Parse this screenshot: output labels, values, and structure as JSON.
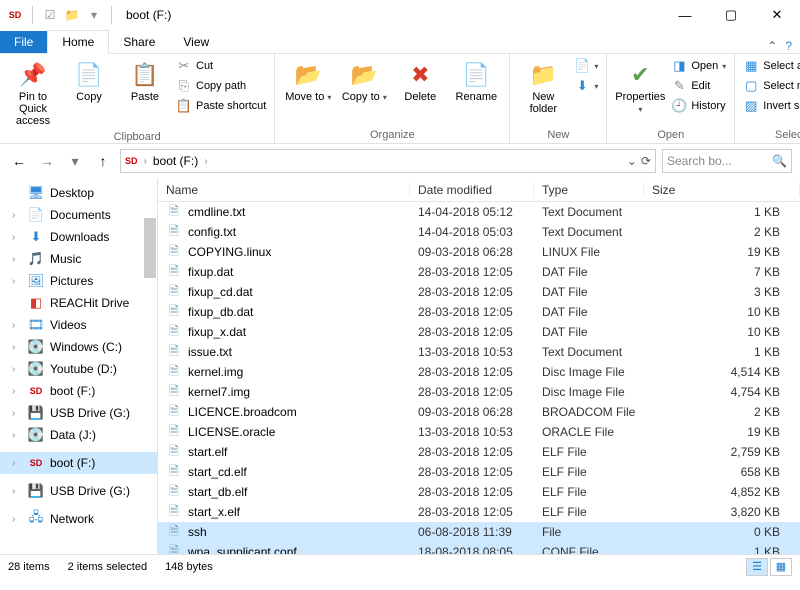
{
  "title": "boot (F:)",
  "ribbon_tabs": {
    "file": "File",
    "home": "Home",
    "share": "Share",
    "view": "View"
  },
  "ribbon": {
    "clipboard": {
      "pin": "Pin to Quick access",
      "copy": "Copy",
      "paste": "Paste",
      "cut": "Cut",
      "copy_path": "Copy path",
      "paste_shortcut": "Paste shortcut",
      "label": "Clipboard"
    },
    "organize": {
      "move_to": "Move to",
      "copy_to": "Copy to",
      "delete": "Delete",
      "rename": "Rename",
      "label": "Organize"
    },
    "new": {
      "new_folder": "New folder",
      "label": "New"
    },
    "open": {
      "properties": "Properties",
      "open": "Open",
      "edit": "Edit",
      "history": "History",
      "label": "Open"
    },
    "select": {
      "select_all": "Select all",
      "select_none": "Select none",
      "invert": "Invert selection",
      "label": "Select"
    }
  },
  "address": {
    "crumb1": "boot (F:)",
    "search_placeholder": "Search bo..."
  },
  "nav_tree": [
    {
      "icon": "desktop",
      "label": "Desktop",
      "exp": ""
    },
    {
      "icon": "doc",
      "label": "Documents",
      "exp": "›"
    },
    {
      "icon": "download",
      "label": "Downloads",
      "exp": "›"
    },
    {
      "icon": "music",
      "label": "Music",
      "exp": "›"
    },
    {
      "icon": "picture",
      "label": "Pictures",
      "exp": "›"
    },
    {
      "icon": "reachit",
      "label": "REACHit Drive",
      "exp": ""
    },
    {
      "icon": "video",
      "label": "Videos",
      "exp": "›"
    },
    {
      "icon": "drive",
      "label": "Windows (C:)",
      "exp": "›"
    },
    {
      "icon": "drive",
      "label": "Youtube (D:)",
      "exp": "›"
    },
    {
      "icon": "sd",
      "label": "boot (F:)",
      "exp": "›"
    },
    {
      "icon": "usb",
      "label": "USB Drive (G:)",
      "exp": "›"
    },
    {
      "icon": "drive",
      "label": "Data (J:)",
      "exp": "›"
    },
    {
      "spacer": true
    },
    {
      "icon": "sd",
      "label": "boot (F:)",
      "exp": "›",
      "selected": true
    },
    {
      "spacer": true
    },
    {
      "icon": "usb",
      "label": "USB Drive (G:)",
      "exp": "›"
    },
    {
      "spacer": true
    },
    {
      "icon": "network",
      "label": "Network",
      "exp": "›"
    }
  ],
  "columns": {
    "name": "Name",
    "date": "Date modified",
    "type": "Type",
    "size": "Size"
  },
  "files": [
    {
      "name": "cmdline.txt",
      "date": "14-04-2018 05:12",
      "type": "Text Document",
      "size": "1 KB"
    },
    {
      "name": "config.txt",
      "date": "14-04-2018 05:03",
      "type": "Text Document",
      "size": "2 KB"
    },
    {
      "name": "COPYING.linux",
      "date": "09-03-2018 06:28",
      "type": "LINUX File",
      "size": "19 KB"
    },
    {
      "name": "fixup.dat",
      "date": "28-03-2018 12:05",
      "type": "DAT File",
      "size": "7 KB"
    },
    {
      "name": "fixup_cd.dat",
      "date": "28-03-2018 12:05",
      "type": "DAT File",
      "size": "3 KB"
    },
    {
      "name": "fixup_db.dat",
      "date": "28-03-2018 12:05",
      "type": "DAT File",
      "size": "10 KB"
    },
    {
      "name": "fixup_x.dat",
      "date": "28-03-2018 12:05",
      "type": "DAT File",
      "size": "10 KB"
    },
    {
      "name": "issue.txt",
      "date": "13-03-2018 10:53",
      "type": "Text Document",
      "size": "1 KB"
    },
    {
      "name": "kernel.img",
      "date": "28-03-2018 12:05",
      "type": "Disc Image File",
      "size": "4,514 KB"
    },
    {
      "name": "kernel7.img",
      "date": "28-03-2018 12:05",
      "type": "Disc Image File",
      "size": "4,754 KB"
    },
    {
      "name": "LICENCE.broadcom",
      "date": "09-03-2018 06:28",
      "type": "BROADCOM File",
      "size": "2 KB"
    },
    {
      "name": "LICENSE.oracle",
      "date": "13-03-2018 10:53",
      "type": "ORACLE File",
      "size": "19 KB"
    },
    {
      "name": "start.elf",
      "date": "28-03-2018 12:05",
      "type": "ELF File",
      "size": "2,759 KB"
    },
    {
      "name": "start_cd.elf",
      "date": "28-03-2018 12:05",
      "type": "ELF File",
      "size": "658 KB"
    },
    {
      "name": "start_db.elf",
      "date": "28-03-2018 12:05",
      "type": "ELF File",
      "size": "4,852 KB"
    },
    {
      "name": "start_x.elf",
      "date": "28-03-2018 12:05",
      "type": "ELF File",
      "size": "3,820 KB"
    },
    {
      "name": "ssh",
      "date": "06-08-2018 11:39",
      "type": "File",
      "size": "0 KB",
      "selected": true
    },
    {
      "name": "wpa_supplicant.conf",
      "date": "18-08-2018 08:05",
      "type": "CONF File",
      "size": "1 KB",
      "selected": true
    }
  ],
  "status": {
    "items": "28 items",
    "selected": "2 items selected",
    "bytes": "148 bytes"
  }
}
